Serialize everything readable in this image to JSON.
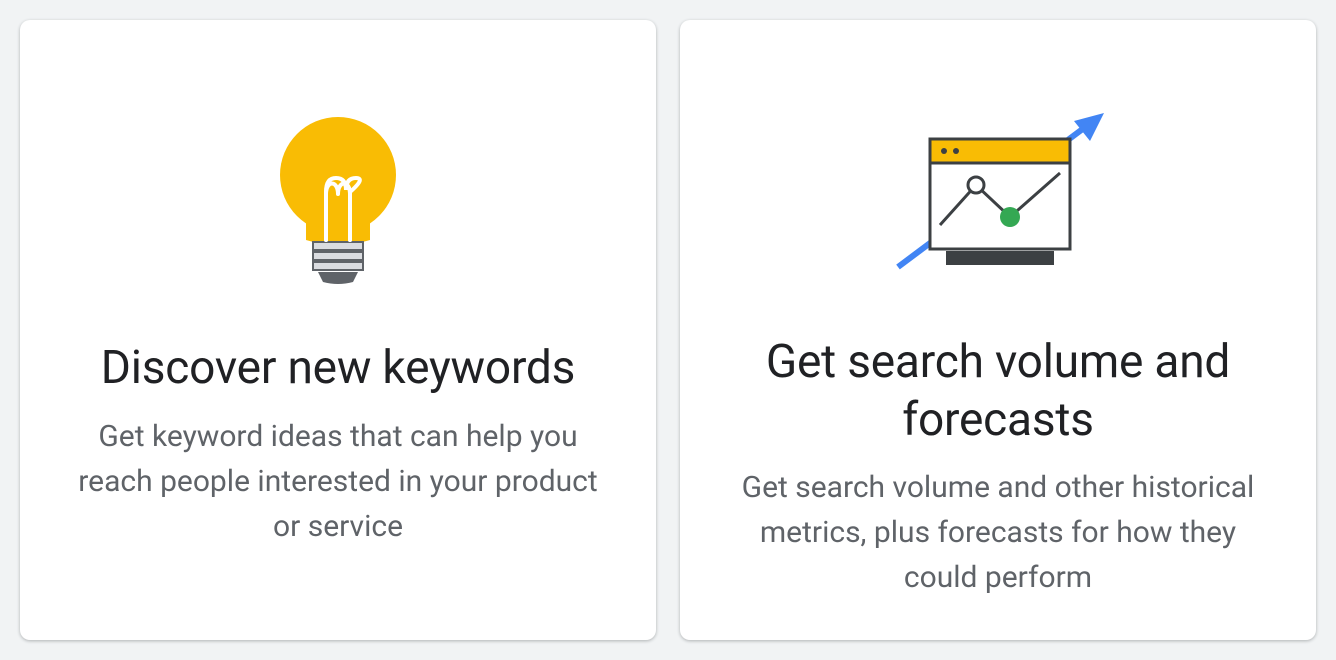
{
  "cards": [
    {
      "title": "Discover new keywords",
      "desc": "Get keyword ideas that can help you reach people interested in your product or service"
    },
    {
      "title": "Get search volume and forecasts",
      "desc": "Get search volume and other historical metrics, plus forecasts for how they could perform"
    }
  ],
  "colors": {
    "yellow": "#f9bc04",
    "blue": "#4285f4",
    "green": "#34a853",
    "dark": "#3c4043",
    "gray": "#dadce0"
  }
}
